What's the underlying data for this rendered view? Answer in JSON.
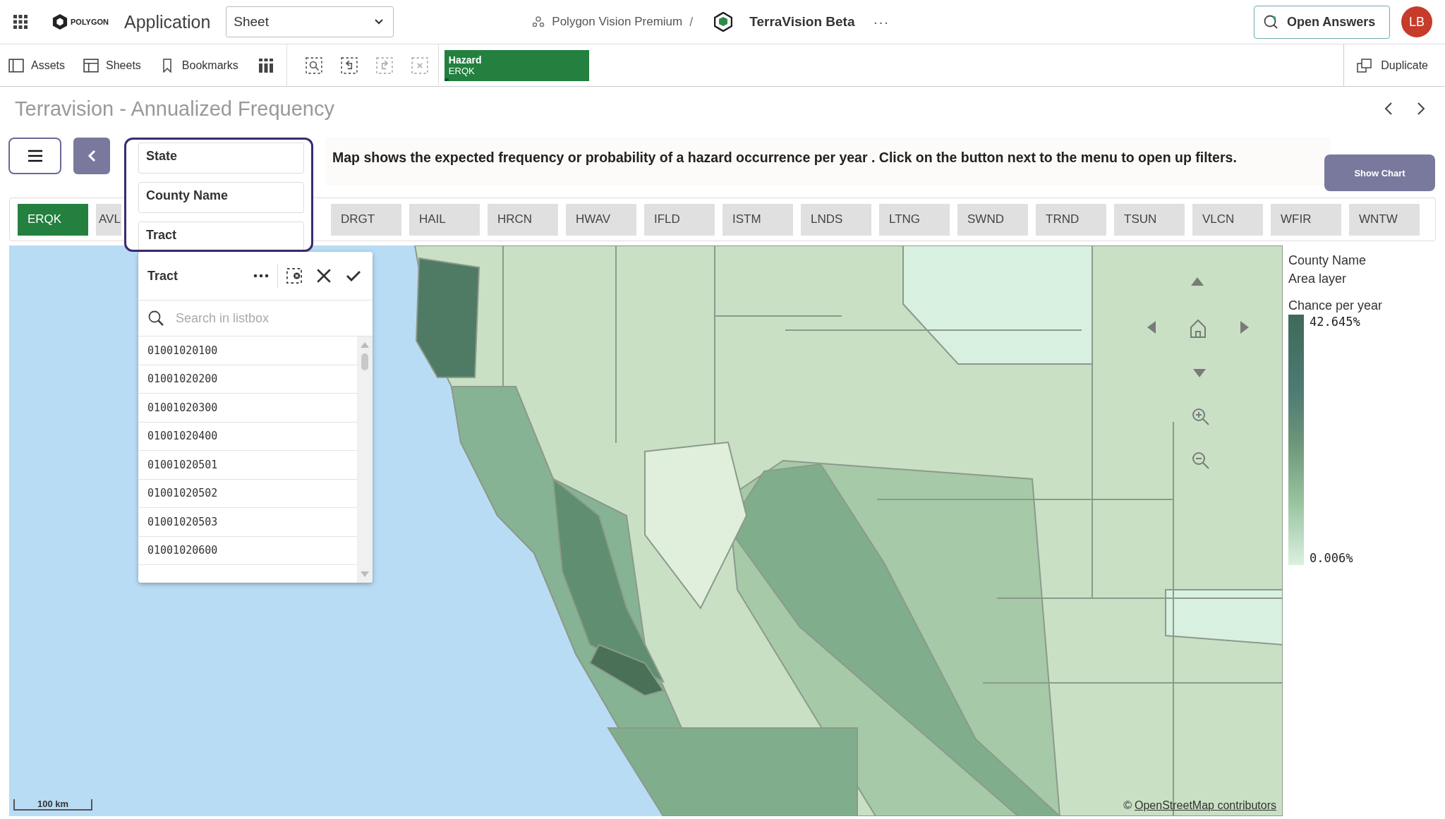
{
  "top_bar": {
    "logo_text": "POLYGON",
    "app_name": "Application",
    "sheet_select": "Sheet",
    "space": "Polygon Vision Premium",
    "separator": "/",
    "app_title": "TerraVision Beta",
    "more": "···",
    "open_answers": "Open Answers",
    "avatar": "LB"
  },
  "toolbar": {
    "items": [
      {
        "label": "Assets"
      },
      {
        "label": "Sheets"
      },
      {
        "label": "Bookmarks"
      }
    ],
    "selection_chip": {
      "title": "Hazard",
      "value": "ERQK",
      "level": 0.03
    },
    "duplicate": "Duplicate"
  },
  "sheet_title": "Terravision - Annualized Frequency",
  "filters": {
    "items": [
      {
        "label": "State"
      },
      {
        "label": "County Name"
      },
      {
        "label": "Tract"
      }
    ]
  },
  "info_text": "Map shows the expected frequency or probability of a hazard occurrence per year . Click on the button next to the menu to open up filters.",
  "show_chart": "Show Chart",
  "hazard_tabs": [
    {
      "label": "ERQK",
      "selected": true
    },
    {
      "label": "AVL",
      "selected": false
    },
    {
      "label": "DRGT",
      "selected": false
    },
    {
      "label": "HAIL",
      "selected": false
    },
    {
      "label": "HRCN",
      "selected": false
    },
    {
      "label": "HWAV",
      "selected": false
    },
    {
      "label": "IFLD",
      "selected": false
    },
    {
      "label": "ISTM",
      "selected": false
    },
    {
      "label": "LNDS",
      "selected": false
    },
    {
      "label": "LTNG",
      "selected": false
    },
    {
      "label": "SWND",
      "selected": false
    },
    {
      "label": "TRND",
      "selected": false
    },
    {
      "label": "TSUN",
      "selected": false
    },
    {
      "label": "VLCN",
      "selected": false
    },
    {
      "label": "WFIR",
      "selected": false
    },
    {
      "label": "WNTW",
      "selected": false
    }
  ],
  "listbox": {
    "title": "Tract",
    "placeholder": "Search in listbox",
    "items": [
      "01001020100",
      "01001020200",
      "01001020300",
      "01001020400",
      "01001020501",
      "01001020502",
      "01001020503",
      "01001020600"
    ]
  },
  "map": {
    "scale": "100 km",
    "copyright": "©",
    "attribution": "OpenStreetMap contributors",
    "legend": {
      "title": "County Name",
      "subtitle": "Area layer",
      "measure": "Chance per year",
      "max": "42.645%",
      "min": "0.006%"
    }
  }
}
